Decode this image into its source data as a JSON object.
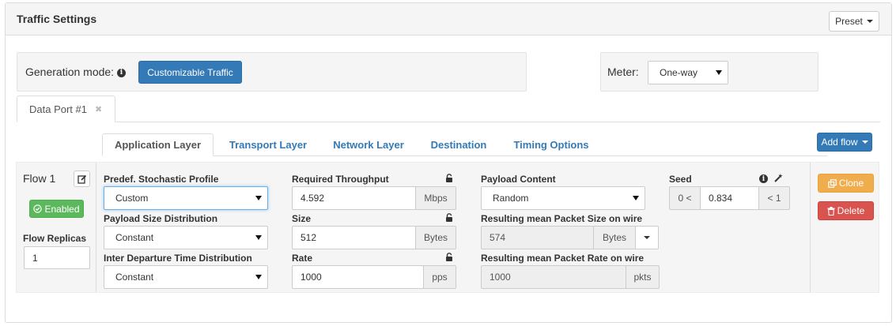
{
  "panel": {
    "title": "Traffic Settings",
    "preset_label": "Preset"
  },
  "generation": {
    "label": "Generation mode:",
    "mode_button": "Customizable Traffic"
  },
  "meter": {
    "label": "Meter:",
    "selected": "One-way"
  },
  "port_tab": {
    "label": "Data Port #1",
    "close_glyph": "✖"
  },
  "tabs": [
    {
      "label": "Application Layer",
      "active": true
    },
    {
      "label": "Transport Layer"
    },
    {
      "label": "Network Layer"
    },
    {
      "label": "Destination"
    },
    {
      "label": "Timing Options"
    }
  ],
  "add_flow_label": "Add flow",
  "flow": {
    "name": "Flow 1",
    "enabled_label": "Enabled",
    "replicas_label": "Flow Replicas",
    "replicas_value": "1"
  },
  "fields": {
    "profile": {
      "label": "Predef. Stochastic Profile",
      "value": "Custom"
    },
    "payload_size_dist": {
      "label": "Payload Size Distribution",
      "value": "Constant"
    },
    "inter_departure": {
      "label": "Inter Departure Time Distribution",
      "value": "Constant"
    },
    "throughput": {
      "label": "Required Throughput",
      "value": "4.592",
      "unit": "Mbps"
    },
    "size": {
      "label": "Size",
      "value": "512",
      "unit": "Bytes"
    },
    "rate": {
      "label": "Rate",
      "value": "1000",
      "unit": "pps"
    },
    "payload_content": {
      "label": "Payload Content",
      "value": "Random"
    },
    "mean_size": {
      "label": "Resulting mean Packet Size on wire",
      "value": "574",
      "unit": "Bytes"
    },
    "mean_rate": {
      "label": "Resulting mean Packet Rate on wire",
      "value": "1000",
      "unit": "pkts"
    },
    "seed": {
      "label": "Seed",
      "prefix": "0 <",
      "value": "0.834",
      "suffix": "< 1"
    }
  },
  "actions": {
    "clone_label": "Clone",
    "delete_label": "Delete"
  },
  "colors": {
    "primary": "#337ab7",
    "success": "#5cb85c",
    "warning": "#f0ad4e",
    "danger": "#d9534f"
  },
  "icons": [
    "info-icon",
    "lock-icon",
    "edit-icon",
    "check-circle-icon",
    "magic-wand-icon",
    "copy-icon",
    "trash-icon",
    "close-icon",
    "chevron-down-icon"
  ]
}
